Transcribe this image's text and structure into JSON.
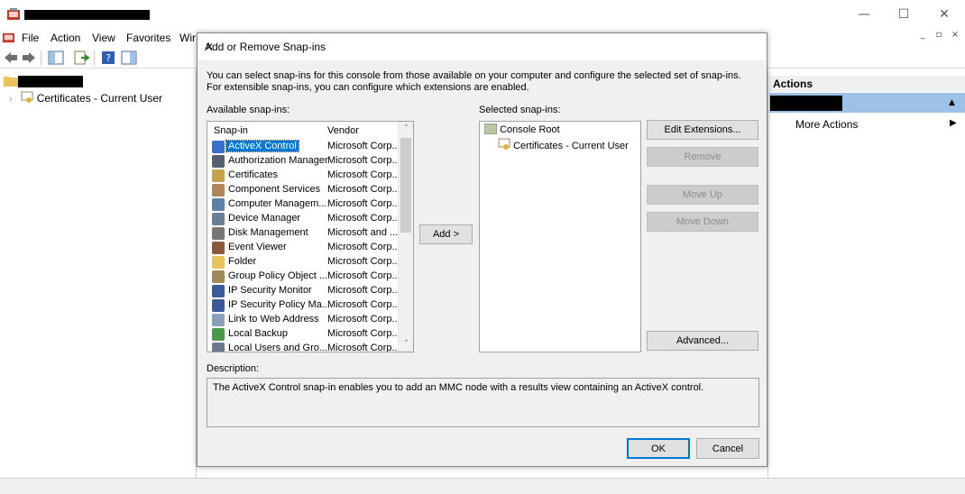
{
  "window": {
    "menu": [
      "File",
      "Action",
      "View",
      "Favorites",
      "Wir"
    ],
    "controls": {
      "minimize": "—",
      "maximize": "☐",
      "close": "✕"
    },
    "tree_item": "Certificates - Current User",
    "actions_title": "Actions",
    "more_actions": "More Actions"
  },
  "dialog": {
    "title": "Add or Remove Snap-ins",
    "intro": "You can select snap-ins for this console from those available on your computer and configure the selected set of snap-ins. For extensible snap-ins, you can configure which extensions are enabled.",
    "available_label": "Available snap-ins:",
    "selected_label": "Selected snap-ins:",
    "col_snapin": "Snap-in",
    "col_vendor": "Vendor",
    "snapins": [
      {
        "name": "ActiveX Control",
        "vendor": "Microsoft Corp...",
        "icon": "activex-icon",
        "color": "#3a6fd0",
        "selected": true
      },
      {
        "name": "Authorization Manager",
        "vendor": "Microsoft Corp...",
        "icon": "authorization-icon",
        "color": "#556070"
      },
      {
        "name": "Certificates",
        "vendor": "Microsoft Corp...",
        "icon": "certificate-icon",
        "color": "#c8a24a"
      },
      {
        "name": "Component Services",
        "vendor": "Microsoft Corp...",
        "icon": "component-icon",
        "color": "#b0855a"
      },
      {
        "name": "Computer Managem...",
        "vendor": "Microsoft Corp...",
        "icon": "computer-icon",
        "color": "#5b7fa6"
      },
      {
        "name": "Device Manager",
        "vendor": "Microsoft Corp...",
        "icon": "device-icon",
        "color": "#6a7f94"
      },
      {
        "name": "Disk Management",
        "vendor": "Microsoft and ...",
        "icon": "disk-icon",
        "color": "#777777"
      },
      {
        "name": "Event Viewer",
        "vendor": "Microsoft Corp...",
        "icon": "event-icon",
        "color": "#8a5a3a"
      },
      {
        "name": "Folder",
        "vendor": "Microsoft Corp...",
        "icon": "folder-icon",
        "color": "#e8c25a"
      },
      {
        "name": "Group Policy Object ...",
        "vendor": "Microsoft Corp...",
        "icon": "policy-icon",
        "color": "#a08a5a"
      },
      {
        "name": "IP Security Monitor",
        "vendor": "Microsoft Corp...",
        "icon": "ipsec-monitor-icon",
        "color": "#3a5a9a"
      },
      {
        "name": "IP Security Policy Ma...",
        "vendor": "Microsoft Corp...",
        "icon": "ipsec-policy-icon",
        "color": "#3a5a9a"
      },
      {
        "name": "Link to Web Address",
        "vendor": "Microsoft Corp...",
        "icon": "link-icon",
        "color": "#8aa0b8"
      },
      {
        "name": "Local Backup",
        "vendor": "Microsoft Corp...",
        "icon": "backup-icon",
        "color": "#4a9a4a"
      },
      {
        "name": "Local Users and Gro...",
        "vendor": "Microsoft Corp...",
        "icon": "users-icon",
        "color": "#6a7a8a"
      }
    ],
    "selected": {
      "root": "Console Root",
      "child": "Certificates - Current User"
    },
    "buttons": {
      "add": "Add >",
      "edit_ext": "Edit Extensions...",
      "remove": "Remove",
      "move_up": "Move Up",
      "move_down": "Move Down",
      "advanced": "Advanced...",
      "ok": "OK",
      "cancel": "Cancel"
    },
    "description_label": "Description:",
    "description": "The ActiveX Control snap-in enables you to add an MMC node with a results view containing an ActiveX control."
  }
}
